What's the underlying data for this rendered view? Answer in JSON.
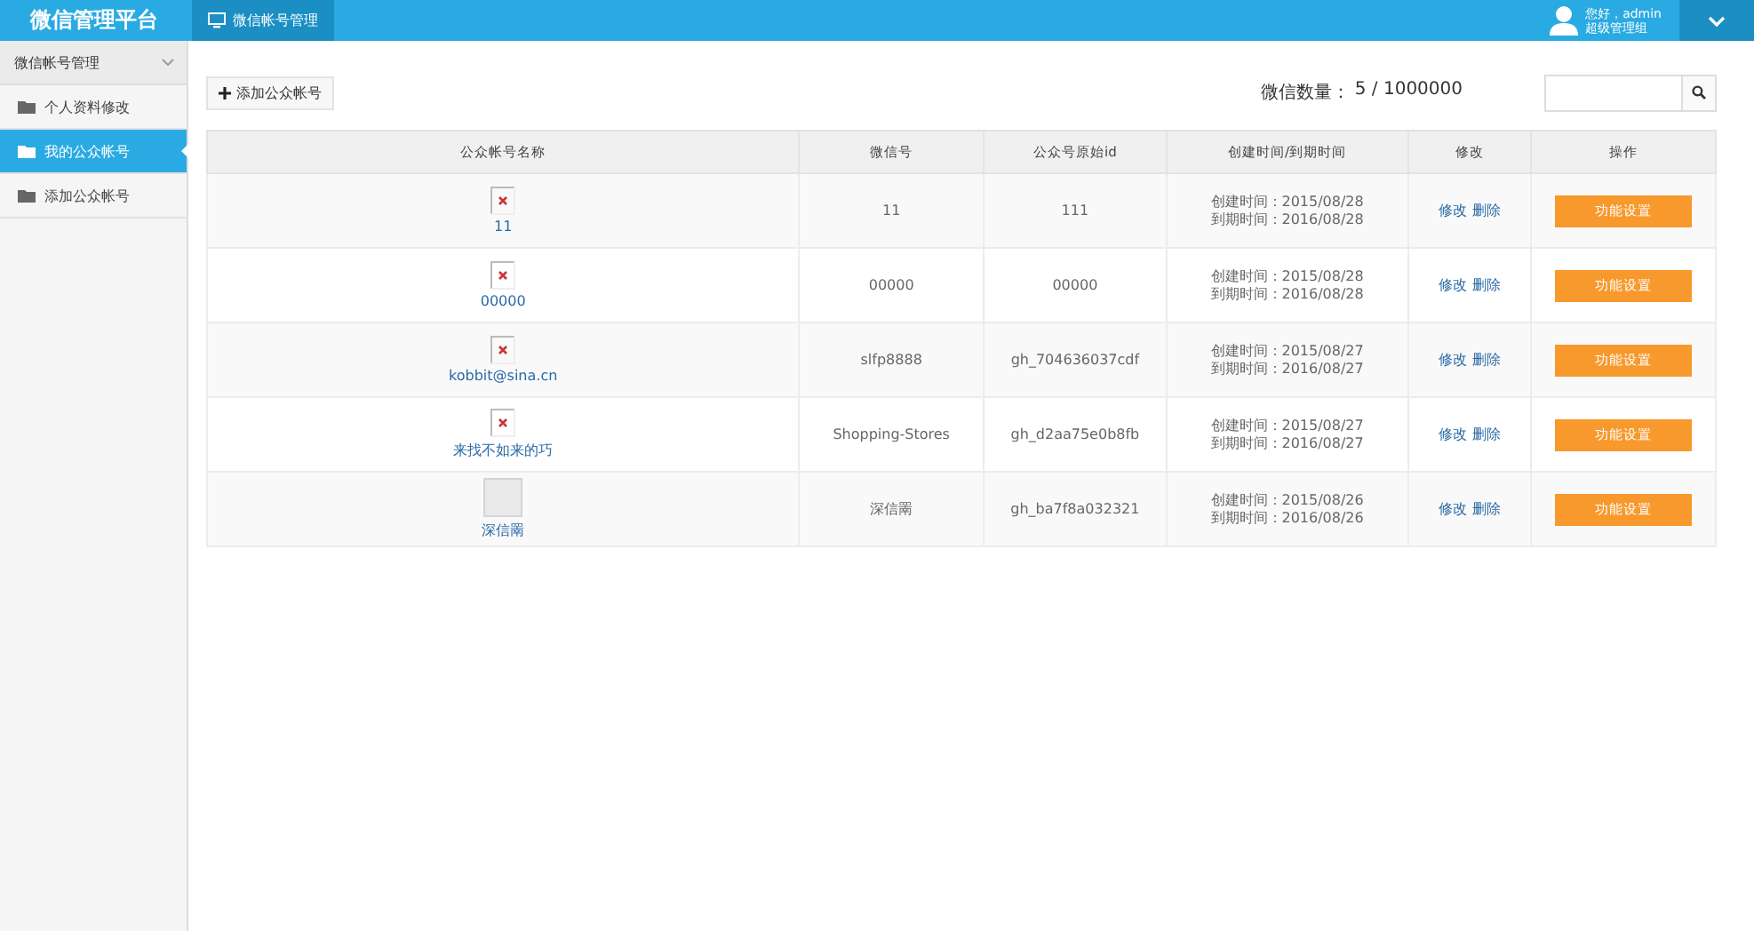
{
  "topbar": {
    "brand": "微信管理平台",
    "tabs": [
      {
        "label": "微信帐号管理",
        "selected": true
      }
    ],
    "user": {
      "greeting": "您好，admin",
      "role": "超级管理组"
    }
  },
  "sidebar": {
    "group": {
      "label": "微信帐号管理",
      "expanded": true
    },
    "items": [
      {
        "label": "个人资料修改",
        "selected": false
      },
      {
        "label": "我的公众帐号",
        "selected": true
      },
      {
        "label": "添加公众帐号",
        "selected": false
      }
    ]
  },
  "toolbar": {
    "add_button": "添加公众帐号",
    "count_label": "微信数量：",
    "count": "5 / 1000000"
  },
  "table": {
    "columns": [
      "公众帐号名称",
      "微信号",
      "公众号原始id",
      "创建时间/到期时间",
      "修改",
      "操作"
    ],
    "rows": [
      {
        "kind": "broken",
        "name": "11",
        "wechat_id": "11",
        "original_id": "111",
        "created": "创建时间：2015/08/28",
        "expires": "到期时间：2016/08/28",
        "edit": "修改",
        "delete": "删除",
        "action": "功能设置"
      },
      {
        "kind": "broken",
        "name": "00000",
        "wechat_id": "00000",
        "original_id": "00000",
        "created": "创建时间：2015/08/28",
        "expires": "到期时间：2016/08/28",
        "edit": "修改",
        "delete": "删除",
        "action": "功能设置"
      },
      {
        "kind": "broken",
        "name": "kobbit@sina.cn",
        "wechat_id": "slfp8888",
        "original_id": "gh_704636037cdf",
        "created": "创建时间：2015/08/27",
        "expires": "到期时间：2016/08/27",
        "edit": "修改",
        "delete": "删除",
        "action": "功能设置"
      },
      {
        "kind": "broken",
        "name": "来找不如来的巧",
        "wechat_id": "Shopping-Stores",
        "original_id": "gh_d2aa75e0b8fb",
        "created": "创建时间：2015/08/27",
        "expires": "到期时间：2016/08/27",
        "edit": "修改",
        "delete": "删除",
        "action": "功能设置"
      },
      {
        "kind": "thumbnail",
        "name": "深信罱",
        "wechat_id": "深信罱",
        "original_id": "gh_ba7f8a032321",
        "created": "创建时间：2015/08/26",
        "expires": "到期时间：2016/08/26",
        "edit": "修改",
        "delete": "删除",
        "action": "功能设置"
      }
    ]
  }
}
